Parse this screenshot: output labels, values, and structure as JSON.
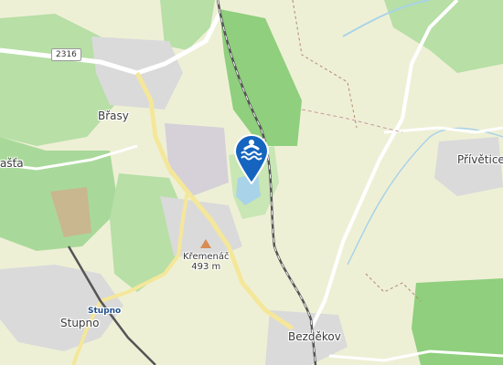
{
  "map": {
    "labels": {
      "brasy": "Břasy",
      "dasta": "ašťa",
      "privetice": "Přívětice",
      "kremenac_name": "Křemenáč",
      "kremenac_elev": "493 m",
      "stupno_stop": "Stupno",
      "stupno": "Stupno",
      "bezdekov": "Bezděkov"
    },
    "road_number": "2316",
    "marker": {
      "icon": "swimming-icon",
      "color": "#1565c0"
    },
    "colors": {
      "background": "#eef0d6",
      "forest": "#b7dfa6",
      "forest_dark": "#8fcf7d",
      "water": "#a9d3e8",
      "road": "#ffffff",
      "road_major": "#f4e79a",
      "railway": "#555555",
      "urban": "#d9d9d9"
    }
  }
}
